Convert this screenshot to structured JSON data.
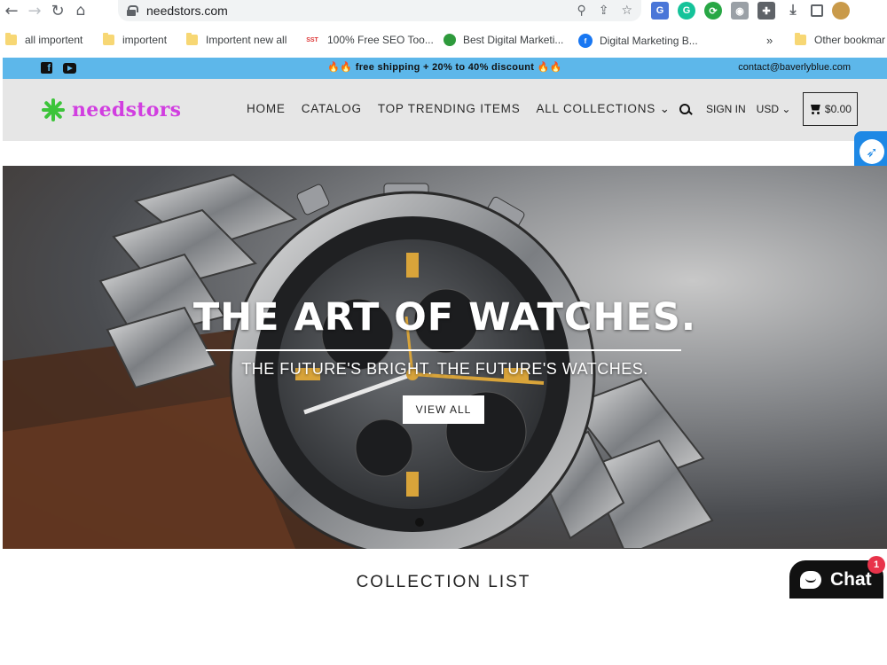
{
  "browser": {
    "url": "needstors.com",
    "bookmarks": [
      {
        "label": "all importent",
        "type": "folder"
      },
      {
        "label": "importent",
        "type": "folder"
      },
      {
        "label": "Importent new all",
        "type": "folder"
      },
      {
        "label": "100% Free SEO Too...",
        "type": "site"
      },
      {
        "label": "Best Digital Marketi...",
        "type": "site"
      },
      {
        "label": "Digital Marketing B...",
        "type": "site"
      },
      {
        "label": "Other bookmar",
        "type": "folder"
      }
    ],
    "overflow_label": "»"
  },
  "announcement": {
    "message": "free shipping + 20% to 40% discount",
    "flame": "🔥🔥",
    "contact": "contact@baverlyblue.com"
  },
  "header": {
    "logo_text": "needstors",
    "menu": [
      {
        "label": "HOME"
      },
      {
        "label": "CATALOG"
      },
      {
        "label": "TOP TRENDING ITEMS"
      },
      {
        "label": "ALL COLLECTIONS ⌄"
      }
    ],
    "sign_in": "SIGN IN",
    "currency": "USD ⌄",
    "cart_total": "$0.00"
  },
  "hero": {
    "title": "THE ART OF WATCHES.",
    "subtitle": "THE FUTURE'S BRIGHT. THE FUTURE'S WATCHES.",
    "button": "VIEW ALL"
  },
  "section": {
    "title": "COLLECTION LIST"
  },
  "chat": {
    "label": "Chat",
    "badge": "1"
  },
  "colors": {
    "announce_bg": "#5db7ea",
    "header_bg": "#e6e6e6",
    "logo": "#d13ee0",
    "logo_mark": "#3cc43a",
    "rocket": "#1e88e5",
    "chat_badge": "#e8334a"
  }
}
